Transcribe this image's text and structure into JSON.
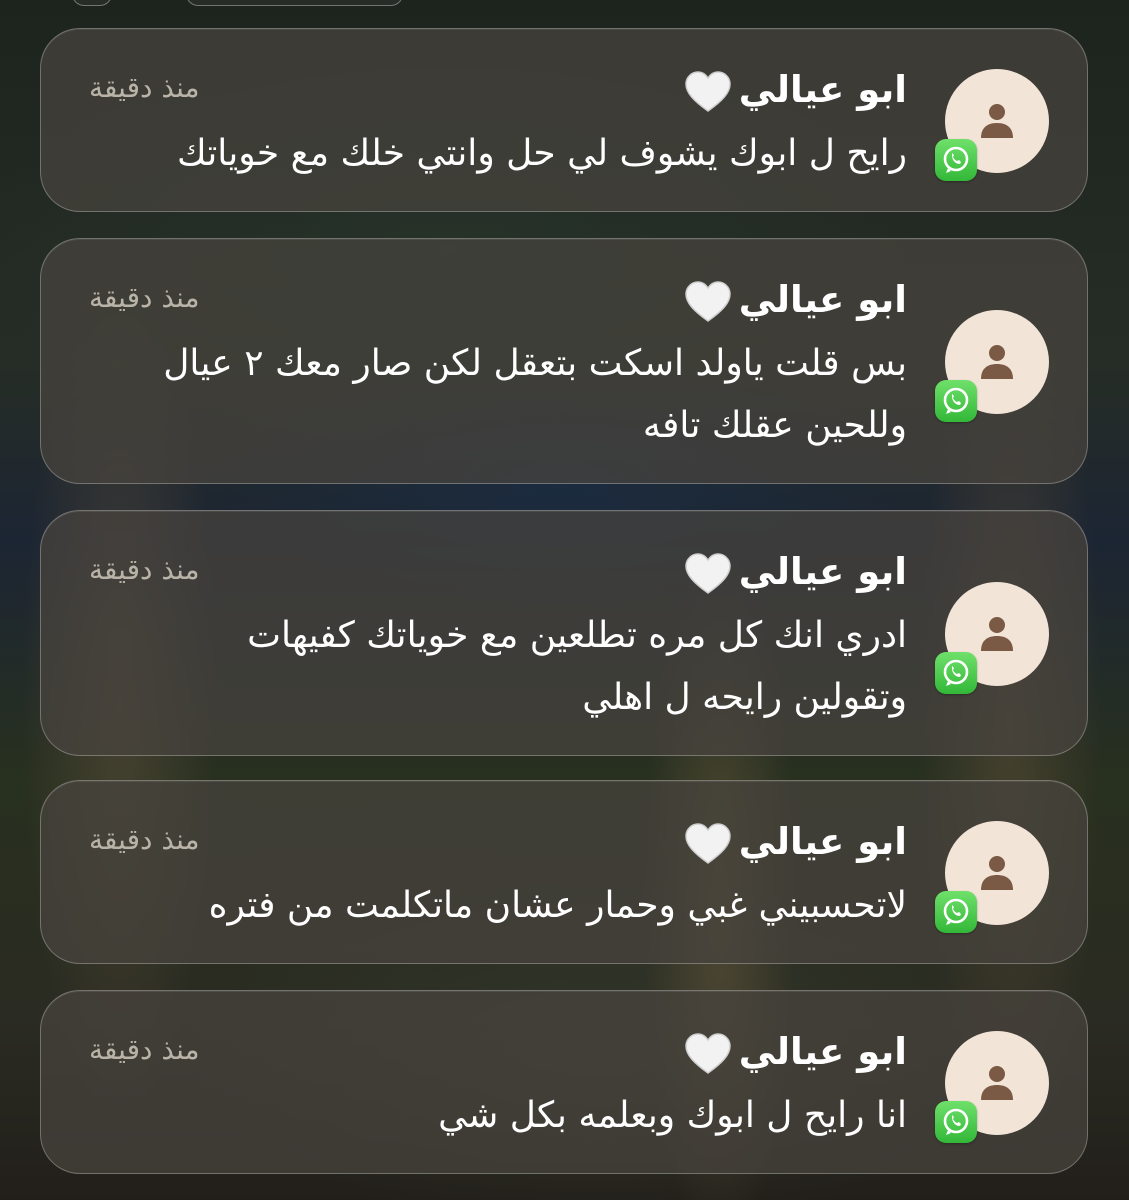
{
  "notifications": [
    {
      "sender": "ابو عيالي",
      "time": "منذ دقيقة",
      "message_lines": [
        "رايح ل ابوك يشوف لي حل وانتي خلك مع خوياتك"
      ],
      "app_icon": "whatsapp-icon",
      "avatar_icon": "person-icon"
    },
    {
      "sender": "ابو عيالي",
      "time": "منذ دقيقة",
      "message_lines": [
        "بس قلت ياولد اسكت بتعقل لكن صار معك ٢ عيال",
        "وللحين عقلك تافه"
      ],
      "app_icon": "whatsapp-icon",
      "avatar_icon": "person-icon"
    },
    {
      "sender": "ابو عيالي",
      "time": "منذ دقيقة",
      "message_lines": [
        "ادري انك كل مره تطلعين مع خوياتك كفيهات",
        "وتقولين رايحه ل اهلي"
      ],
      "app_icon": "whatsapp-icon",
      "avatar_icon": "person-icon"
    },
    {
      "sender": "ابو عيالي",
      "time": "منذ دقيقة",
      "message_lines": [
        "لاتحسبيني غبي وحمار عشان ماتكلمت من فتره"
      ],
      "app_icon": "whatsapp-icon",
      "avatar_icon": "person-icon"
    },
    {
      "sender": "ابو عيالي",
      "time": "منذ دقيقة",
      "message_lines": [
        "انا رايح ل ابوك وبعلمه بكل شي"
      ],
      "app_icon": "whatsapp-icon",
      "avatar_icon": "person-icon"
    }
  ],
  "colors": {
    "whatsapp_green": "#33b839",
    "avatar_bg": "#f3e4d8",
    "avatar_figure": "#7a5a44",
    "time_text": "#b9b3a8"
  }
}
